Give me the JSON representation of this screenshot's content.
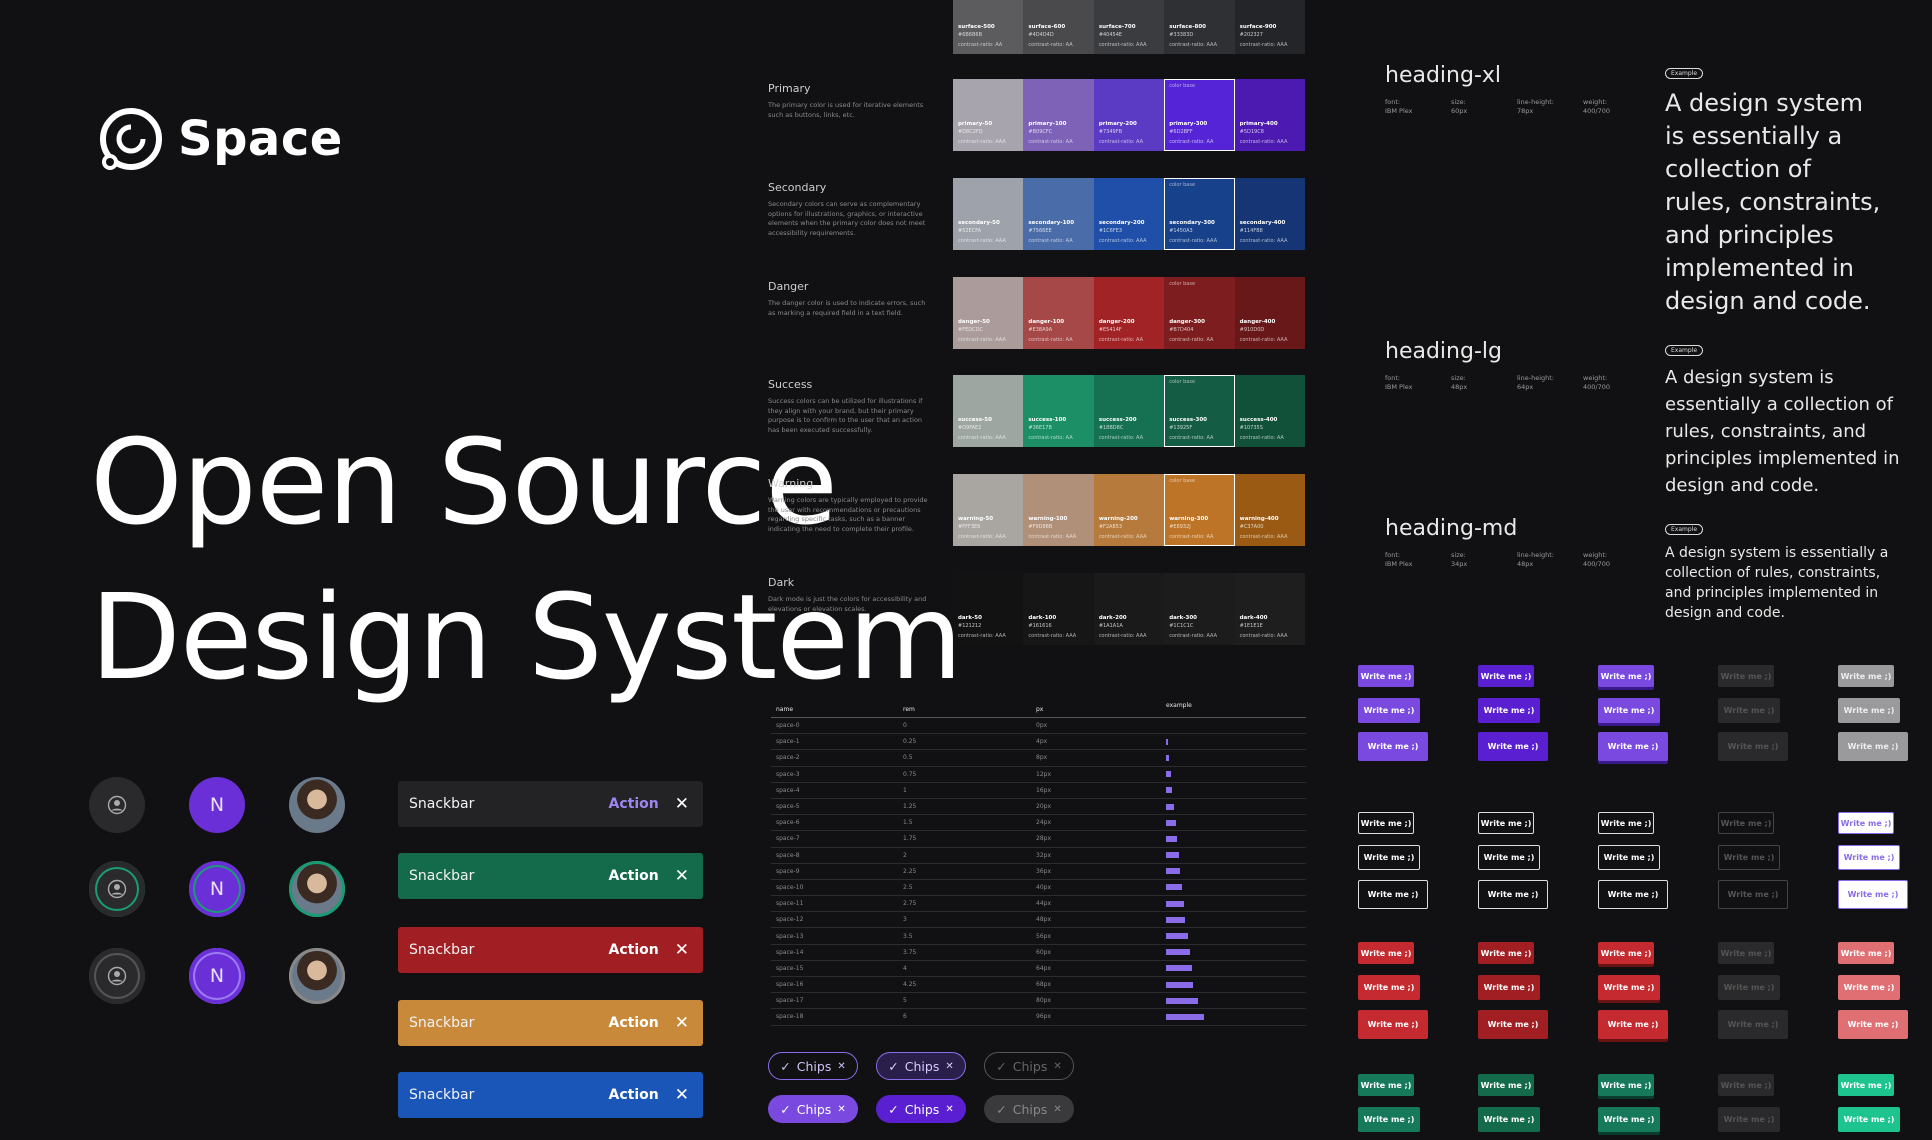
{
  "brand": {
    "name": "Space"
  },
  "hero": {
    "line1": "Open Source",
    "line2": "Design System"
  },
  "avatars": {
    "initial": "N"
  },
  "snackbars": [
    {
      "label": "Snackbar",
      "action": "Action",
      "color": "#232325",
      "action_color": "#9d86f0"
    },
    {
      "label": "Snackbar",
      "action": "Action",
      "color": "#146b4c",
      "action_color": "#ffffff"
    },
    {
      "label": "Snackbar",
      "action": "Action",
      "color": "#a11e22",
      "action_color": "#ffffff"
    },
    {
      "label": "Snackbar",
      "action": "Action",
      "color": "#c88a3a",
      "action_color": "#ffffff"
    },
    {
      "label": "Snackbar",
      "action": "Action",
      "color": "#1a56b8",
      "action_color": "#ffffff"
    }
  ],
  "palette": {
    "surface": {
      "swatches": [
        {
          "name": "surface-500",
          "hex": "#6B6B6B",
          "contrast": "contrast-ratio: AA",
          "color": "#5c5c5e"
        },
        {
          "name": "surface-600",
          "hex": "#4D4D4D",
          "contrast": "contrast-ratio: AA",
          "color": "#4a4a4c"
        },
        {
          "name": "surface-700",
          "hex": "#40454E",
          "contrast": "contrast-ratio: AAA",
          "color": "#3b3c40"
        },
        {
          "name": "surface-800",
          "hex": "#33383D",
          "contrast": "contrast-ratio: AAA",
          "color": "#2f3034"
        },
        {
          "name": "surface-900",
          "hex": "#202327",
          "contrast": "contrast-ratio: AAA",
          "color": "#242528"
        }
      ]
    },
    "groups": [
      {
        "title": "Primary",
        "desc": "The primary color is used for iterative elements such as buttons, links, etc.",
        "swatches": [
          {
            "name": "primary-50",
            "hex": "#D8C2FD",
            "contrast": "contrast-ratio: AAA",
            "color": "#a8a4ae"
          },
          {
            "name": "primary-100",
            "hex": "#B09CFC",
            "contrast": "contrast-ratio: AA",
            "color": "#7d62b8"
          },
          {
            "name": "primary-200",
            "hex": "#7349FB",
            "contrast": "contrast-ratio: AA",
            "color": "#5b3bc4"
          },
          {
            "name": "primary-300",
            "hex": "#6D2BFF",
            "contrast": "contrast-ratio: AA",
            "color": "#5424d6",
            "base": "color base",
            "sel": true
          },
          {
            "name": "primary-400",
            "hex": "#5D19C8",
            "contrast": "contrast-ratio: AAA",
            "color": "#4c1ab0"
          }
        ]
      },
      {
        "title": "Secondary",
        "desc": "Secondary colors can serve as complementary options for illustrations, graphics, or interactive elements when the primary color does not meet accessibility requirements.",
        "swatches": [
          {
            "name": "secondary-50",
            "hex": "#52ECFA",
            "contrast": "contrast-ratio: AAA",
            "color": "#9ea3ab"
          },
          {
            "name": "secondary-100",
            "hex": "#7566EE",
            "contrast": "contrast-ratio: AA",
            "color": "#4a6ca8"
          },
          {
            "name": "secondary-200",
            "hex": "#1C6FE3",
            "contrast": "contrast-ratio: AAA",
            "color": "#1f4fa8"
          },
          {
            "name": "secondary-300",
            "hex": "#1450A3",
            "contrast": "contrast-ratio: AAA",
            "color": "#17418a",
            "base": "color base",
            "sel": true
          },
          {
            "name": "secondary-400",
            "hex": "#114FB8",
            "contrast": "contrast-ratio: AAA",
            "color": "#153575"
          }
        ]
      },
      {
        "title": "Danger",
        "desc": "The danger color is used to indicate errors, such as marking a required field in a text field.",
        "swatches": [
          {
            "name": "danger-50",
            "hex": "#FEDCDC",
            "contrast": "contrast-ratio: AAA",
            "color": "#ab9b9b"
          },
          {
            "name": "danger-100",
            "hex": "#E38A9A",
            "contrast": "contrast-ratio: AA",
            "color": "#a64848"
          },
          {
            "name": "danger-200",
            "hex": "#E5414F",
            "contrast": "contrast-ratio: AA",
            "color": "#a12326"
          },
          {
            "name": "danger-300",
            "hex": "#B7D404",
            "contrast": "contrast-ratio: AA",
            "color": "#7e1d1f",
            "base": "color base"
          },
          {
            "name": "danger-400",
            "hex": "#910D0D",
            "contrast": "contrast-ratio: AAA",
            "color": "#681818"
          }
        ]
      },
      {
        "title": "Success",
        "desc": "Success colors can be utilized for illustrations if they align with your brand, but their primary purpose is to confirm to the user that an action has been executed successfully.",
        "swatches": [
          {
            "name": "success-50",
            "hex": "#D9FAE2",
            "contrast": "contrast-ratio: AAA",
            "color": "#9ea6a2"
          },
          {
            "name": "success-100",
            "hex": "#36E17B",
            "contrast": "contrast-ratio: AA",
            "color": "#1c8f66"
          },
          {
            "name": "success-200",
            "hex": "#18BD8C",
            "contrast": "contrast-ratio: AA",
            "color": "#167052"
          },
          {
            "name": "success-300",
            "hex": "#13925F",
            "contrast": "contrast-ratio: AA",
            "color": "#145c43",
            "base": "color base",
            "sel": true
          },
          {
            "name": "success-400",
            "hex": "#10735S",
            "contrast": "contrast-ratio: AA",
            "color": "#11513a"
          }
        ]
      },
      {
        "title": "Warning",
        "desc": "Warning colors are typically employed to provide the user with recommendations or precautions regarding specific tasks, such as a banner indicating the need to complete their profile.",
        "swatches": [
          {
            "name": "warning-50",
            "hex": "#FFF3E8",
            "contrast": "contrast-ratio: AAA",
            "color": "#a9a6a2"
          },
          {
            "name": "warning-100",
            "hex": "#F9D88B",
            "contrast": "contrast-ratio: AAA",
            "color": "#b09078"
          },
          {
            "name": "warning-200",
            "hex": "#F2A853",
            "contrast": "contrast-ratio: AAA",
            "color": "#b57a3c"
          },
          {
            "name": "warning-300",
            "hex": "#E8932J",
            "contrast": "contrast-ratio: AA",
            "color": "#bd7426",
            "base": "color base",
            "sel": true
          },
          {
            "name": "warning-400",
            "hex": "#C37A00",
            "contrast": "contrast-ratio: AAA",
            "color": "#9a5a13"
          }
        ]
      },
      {
        "title": "Dark",
        "desc": "Dark mode is just the colors for accessibility and elevations or elevation scales.",
        "swatches": [
          {
            "name": "dark-50",
            "hex": "#121212",
            "contrast": "contrast-ratio: AAA",
            "color": "#121212"
          },
          {
            "name": "dark-100",
            "hex": "#161616",
            "contrast": "contrast-ratio: AAA",
            "color": "#161616"
          },
          {
            "name": "dark-200",
            "hex": "#1A1A1A",
            "contrast": "contrast-ratio: AAA",
            "color": "#1a1a1a"
          },
          {
            "name": "dark-300",
            "hex": "#1C1C1C",
            "contrast": "contrast-ratio: AAA",
            "color": "#1c1c1c"
          },
          {
            "name": "dark-400",
            "hex": "#1E1E1E",
            "contrast": "contrast-ratio: AAA",
            "color": "#1e1e1e"
          }
        ]
      }
    ]
  },
  "spacing": {
    "headers": [
      "name",
      "rem",
      "px",
      "example"
    ],
    "rows": [
      {
        "name": "space-0",
        "rem": "0",
        "px": "0px",
        "size": 0
      },
      {
        "name": "space-1",
        "rem": "0.25",
        "px": "4px",
        "size": 4
      },
      {
        "name": "space-2",
        "rem": "0.5",
        "px": "8px",
        "size": 8
      },
      {
        "name": "space-3",
        "rem": "0.75",
        "px": "12px",
        "size": 12
      },
      {
        "name": "space-4",
        "rem": "1",
        "px": "16px",
        "size": 16
      },
      {
        "name": "space-5",
        "rem": "1.25",
        "px": "20px",
        "size": 20
      },
      {
        "name": "space-6",
        "rem": "1.5",
        "px": "24px",
        "size": 24
      },
      {
        "name": "space-7",
        "rem": "1.75",
        "px": "28px",
        "size": 28
      },
      {
        "name": "space-8",
        "rem": "2",
        "px": "32px",
        "size": 32
      },
      {
        "name": "space-9",
        "rem": "2.25",
        "px": "36px",
        "size": 36
      },
      {
        "name": "space-10",
        "rem": "2.5",
        "px": "40px",
        "size": 40
      },
      {
        "name": "space-11",
        "rem": "2.75",
        "px": "44px",
        "size": 44
      },
      {
        "name": "space-12",
        "rem": "3",
        "px": "48px",
        "size": 48
      },
      {
        "name": "space-13",
        "rem": "3.5",
        "px": "56px",
        "size": 56
      },
      {
        "name": "space-14",
        "rem": "3.75",
        "px": "60px",
        "size": 60
      },
      {
        "name": "space-15",
        "rem": "4",
        "px": "64px",
        "size": 64
      },
      {
        "name": "space-16",
        "rem": "4.25",
        "px": "68px",
        "size": 68
      },
      {
        "name": "space-17",
        "rem": "5",
        "px": "80px",
        "size": 80
      },
      {
        "name": "space-18",
        "rem": "6",
        "px": "96px",
        "size": 96
      }
    ]
  },
  "chips": [
    {
      "label": "Chips",
      "variant": "outline-primary"
    },
    {
      "label": "Chips",
      "variant": "outline-filled"
    },
    {
      "label": "Chips",
      "variant": "outline-disabled"
    },
    {
      "label": "Chips",
      "variant": "filled-primary"
    },
    {
      "label": "Chips",
      "variant": "filled-dark"
    },
    {
      "label": "Chips",
      "variant": "filled-disabled"
    }
  ],
  "typography": {
    "example_label": "Example",
    "tokens": [
      {
        "name": "heading-xl",
        "font_label": "font:",
        "font": "IBM Plex",
        "size_label": "size:",
        "size": "60px",
        "lh_label": "line-height:",
        "lh": "78px",
        "weight_label": "weight:",
        "weight": "400/700",
        "example": "A design system is essentially a collection of rules, constraints, and principles implemented in design and code."
      },
      {
        "name": "heading-lg",
        "font_label": "font:",
        "font": "IBM Plex",
        "size_label": "size:",
        "size": "48px",
        "lh_label": "line-height:",
        "lh": "64px",
        "weight_label": "weight:",
        "weight": "400/700",
        "example": "A design system is essentially a collection of rules, constraints, and principles implemented in design and code."
      },
      {
        "name": "heading-md",
        "font_label": "font:",
        "font": "IBM Plex",
        "size_label": "size:",
        "size": "34px",
        "lh_label": "line-height:",
        "lh": "48px",
        "weight_label": "weight:",
        "weight": "400/700",
        "example": "A design system is essentially a collection of rules, constraints, and principles implemented in design and code."
      }
    ]
  },
  "buttons": {
    "label": "Write me ;)"
  }
}
